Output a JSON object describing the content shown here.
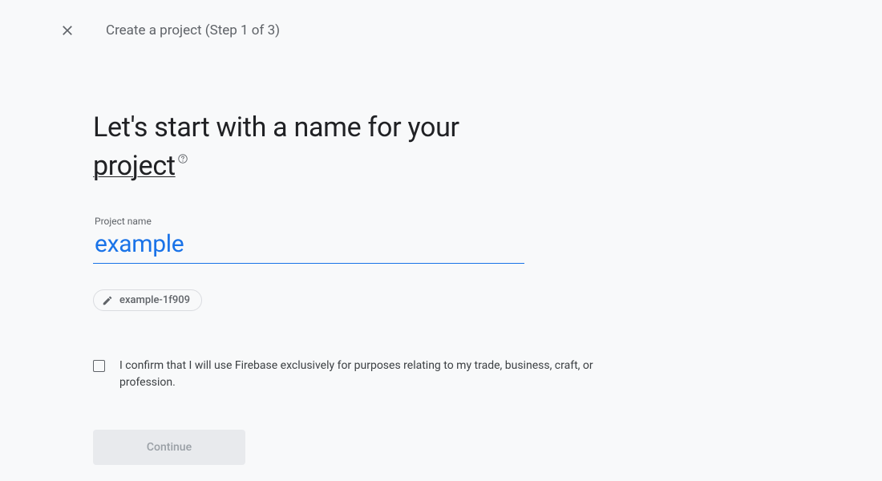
{
  "header": {
    "title": "Create a project (Step 1 of 3)"
  },
  "main": {
    "heading_part1": "Let's start with a name for your ",
    "heading_underlined": "project",
    "field_label": "Project name",
    "project_name_value": "example",
    "project_id_chip": "example-1f909",
    "confirmation_text": "I confirm that I will use Firebase exclusively for purposes relating to my trade, business, craft, or profession.",
    "continue_label": "Continue"
  }
}
